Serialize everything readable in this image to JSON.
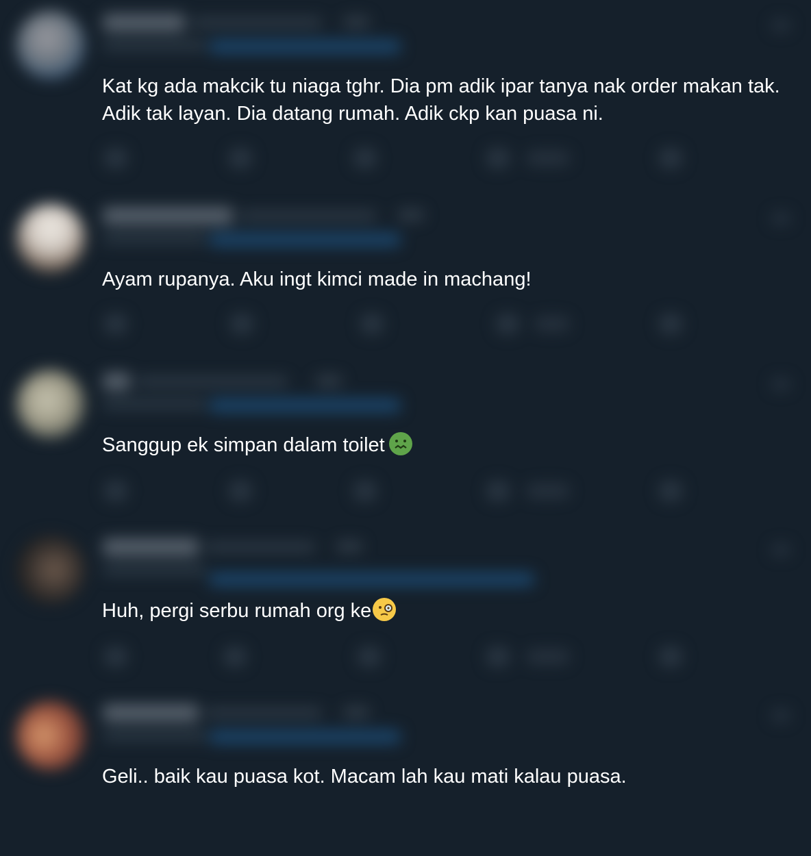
{
  "feed": {
    "replies": [
      {
        "text": "Kat kg ada makcik tu niaga tghr. Dia pm adik ipar tanya nak order makan tak. Adik tak layan. Dia datang rumah. Adik ckp kan puasa ni.",
        "avatar_colors": [
          "#8a8f96",
          "#5b6a77",
          "#2f5d87"
        ],
        "emoji": ""
      },
      {
        "text": "Ayam rupanya. Aku ingt kimci made in machang!",
        "avatar_colors": [
          "#cfc8c0",
          "#e8e3dd",
          "#7a6a5c"
        ],
        "emoji": ""
      },
      {
        "text": "Sanggup ek simpan dalam toilet",
        "avatar_colors": [
          "#b9b8a4",
          "#8e8d7b",
          "#585c55"
        ],
        "emoji": "nauseated-face-emoji"
      },
      {
        "text": "Huh, pergi serbu rumah org ke",
        "avatar_colors": [
          "#3f3a36",
          "#6e5a4c",
          "#1d1c1c"
        ],
        "emoji": "face-with-monocle-emoji"
      },
      {
        "text": "Geli.. baik kau puasa kot. Macam lah kau mati kalau puasa.",
        "avatar_colors": [
          "#c48a63",
          "#8a3f33",
          "#5b2f2a"
        ],
        "emoji": ""
      }
    ]
  }
}
